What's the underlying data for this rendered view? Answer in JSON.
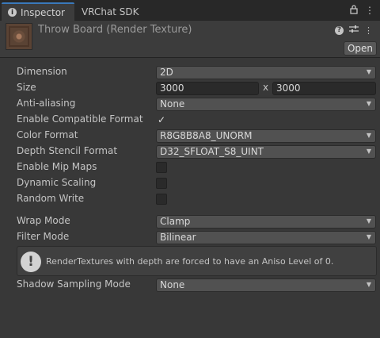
{
  "tabs": [
    {
      "label": "Inspector",
      "icon": "info-icon"
    },
    {
      "label": "VRChat SDK"
    }
  ],
  "header": {
    "title": "Throw Board (Render Texture)",
    "open_label": "Open",
    "icons": [
      "help-icon",
      "settings-sliders-icon",
      "more-icon"
    ]
  },
  "properties": {
    "dimension": {
      "label": "Dimension",
      "value": "2D"
    },
    "size": {
      "label": "Size",
      "width": "3000",
      "x": "x",
      "height": "3000"
    },
    "anti_aliasing": {
      "label": "Anti-aliasing",
      "value": "None"
    },
    "enable_compatible_format": {
      "label": "Enable Compatible Format",
      "checked": true,
      "mark": "✓"
    },
    "color_format": {
      "label": "Color Format",
      "value": "R8G8B8A8_UNORM"
    },
    "depth_stencil_format": {
      "label": "Depth Stencil Format",
      "value": "D32_SFLOAT_S8_UINT"
    },
    "enable_mip_maps": {
      "label": "Enable Mip Maps",
      "checked": false
    },
    "dynamic_scaling": {
      "label": "Dynamic Scaling",
      "checked": false
    },
    "random_write": {
      "label": "Random Write",
      "checked": false
    },
    "wrap_mode": {
      "label": "Wrap Mode",
      "value": "Clamp"
    },
    "filter_mode": {
      "label": "Filter Mode",
      "value": "Bilinear"
    },
    "shadow_sampling_mode": {
      "label": "Shadow Sampling Mode",
      "value": "None"
    }
  },
  "help": {
    "text": "RenderTextures with depth are forced to have an Aniso Level of 0.",
    "icon": "!"
  },
  "colors": {
    "background": "#383838",
    "tab_accent": "#3a79bb",
    "field": "#515151",
    "input": "#2a2a2a"
  }
}
